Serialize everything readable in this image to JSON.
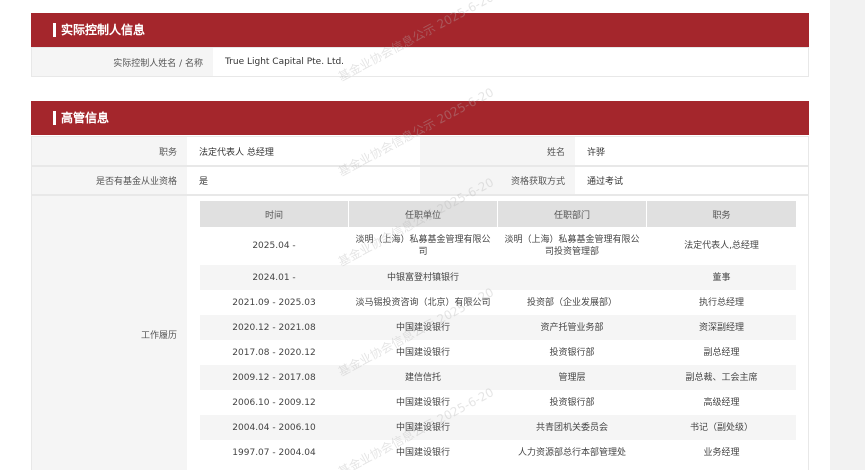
{
  "controller_section": {
    "title": "实际控制人信息",
    "name_label": "实际控制人姓名 / 名称",
    "name_value": "True Light Capital Pte. Ltd."
  },
  "exec_section": {
    "title": "高管信息",
    "position_label": "职务",
    "position_value": "法定代表人 总经理",
    "name_label": "姓名",
    "name_value": "许骅",
    "qualification_label": "是否有基金从业资格",
    "qualification_value": "是",
    "method_label": "资格获取方式",
    "method_value": "通过考试",
    "history_label": "工作履历",
    "history": {
      "headers": [
        "时间",
        "任职单位",
        "任职部门",
        "职务"
      ],
      "rows": [
        [
          "2025.04 -",
          "淡明（上海）私募基金管理有限公司",
          "淡明（上海）私募基金管理有限公司投资管理部",
          "法定代表人,总经理"
        ],
        [
          "2024.01 -",
          "中银富登村镇银行",
          "",
          "董事"
        ],
        [
          "2021.09 - 2025.03",
          "淡马锡投资咨询（北京）有限公司",
          "投资部（企业发展部）",
          "执行总经理"
        ],
        [
          "2020.12 - 2021.08",
          "中国建设银行",
          "资产托管业务部",
          "资深副经理"
        ],
        [
          "2017.08 - 2020.12",
          "中国建设银行",
          "投资银行部",
          "副总经理"
        ],
        [
          "2009.12 - 2017.08",
          "建信信托",
          "管理层",
          "副总裁、工会主席"
        ],
        [
          "2006.10 - 2009.12",
          "中国建设银行",
          "投资银行部",
          "高级经理"
        ],
        [
          "2004.04 - 2006.10",
          "中国建设银行",
          "共青团机关委员会",
          "书记（副处级）"
        ],
        [
          "1997.07 - 2004.04",
          "中国建设银行",
          "人力资源部总行本部管理处",
          "业务经理"
        ]
      ]
    }
  },
  "watermark": {
    "text": "基金业协会信息公示 2025-6-20"
  }
}
